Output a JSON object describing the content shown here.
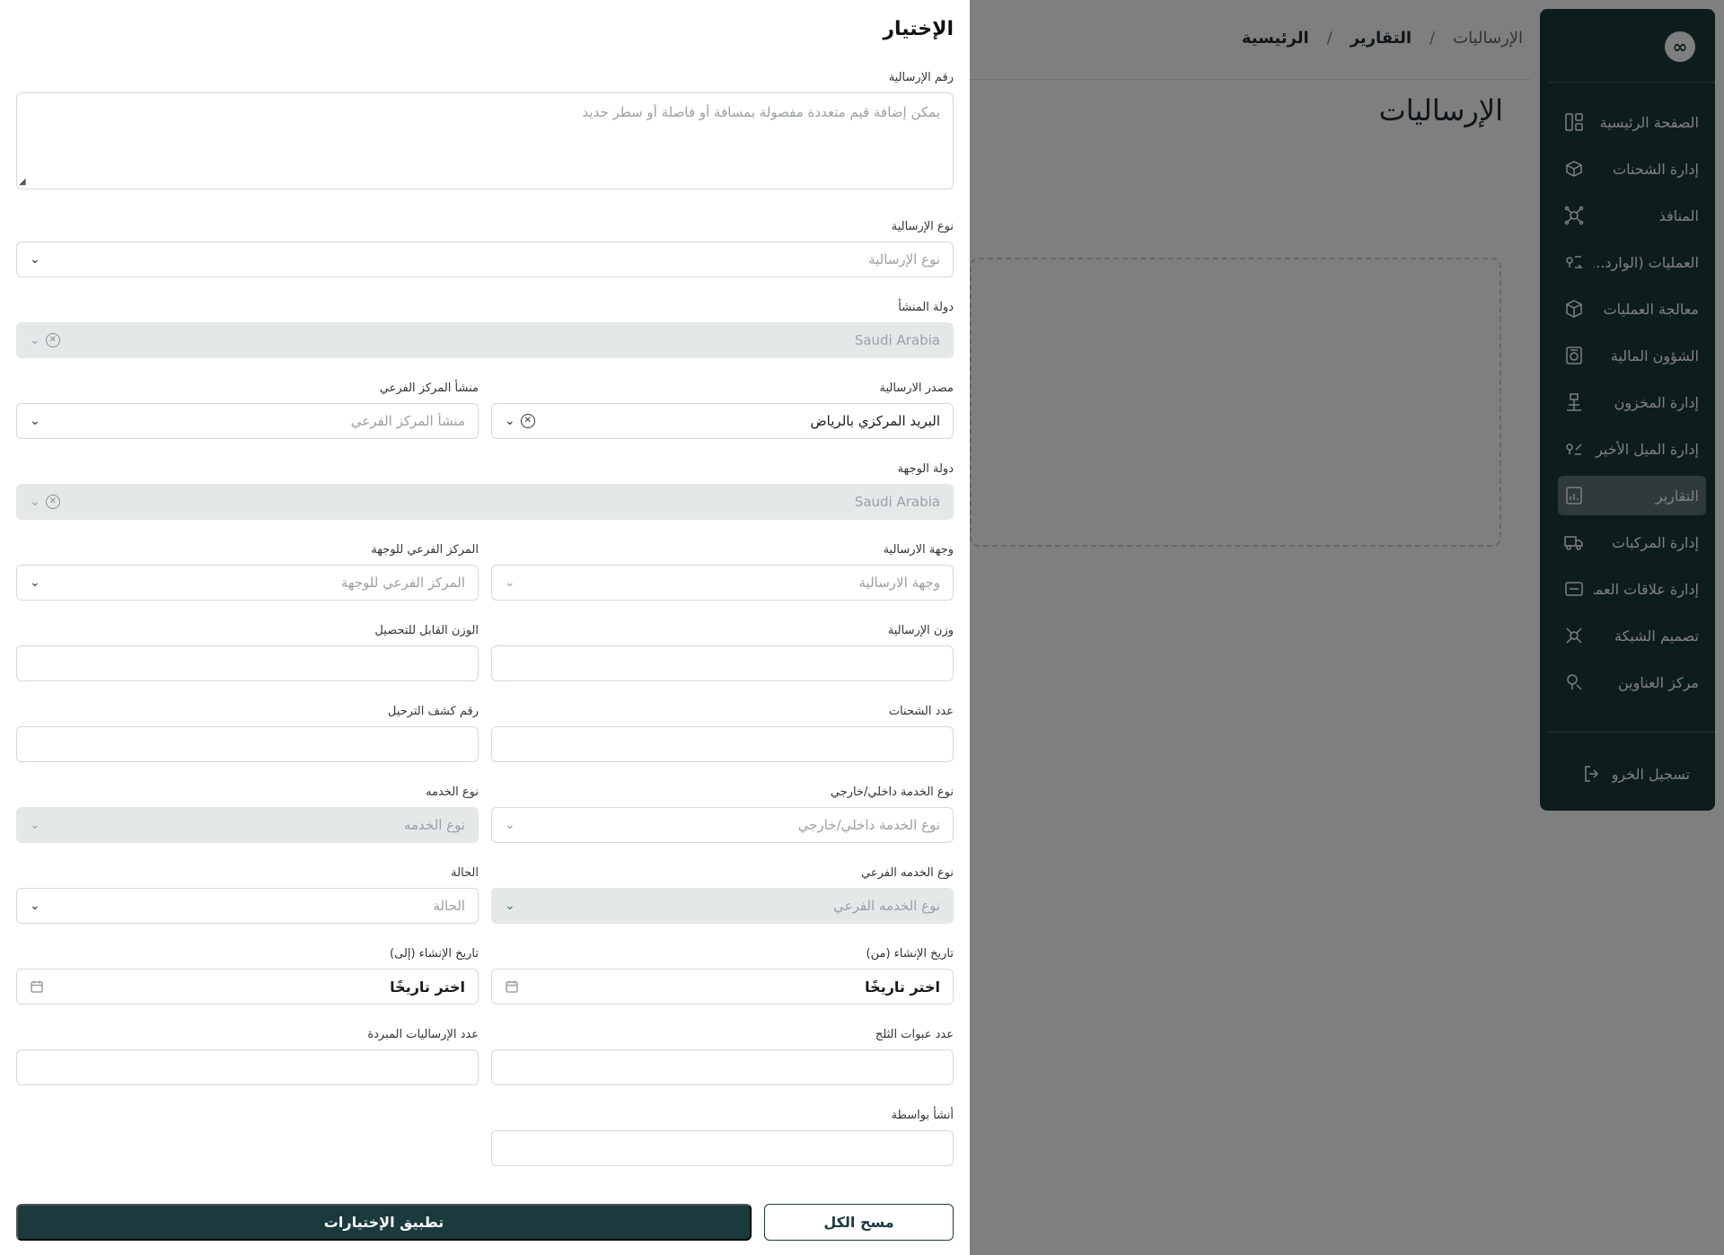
{
  "breadcrumb": {
    "home": "الرئيسية",
    "reports": "التقارير",
    "current": "الإرساليات",
    "sep": "/"
  },
  "page": {
    "title": "الإرساليات"
  },
  "sidebar": {
    "logo": "∞",
    "items": [
      {
        "label": "الصفحة الرئيسية",
        "icon": "dashboard-icon"
      },
      {
        "label": "إدارة الشحنات",
        "icon": "package-icon"
      },
      {
        "label": "المنافذ",
        "icon": "network-icon"
      },
      {
        "label": "العمليات (الوارد...",
        "icon": "location-route-icon"
      },
      {
        "label": "معالجة العمليات",
        "icon": "box-icon"
      },
      {
        "label": "الشؤون المالية",
        "icon": "finance-icon"
      },
      {
        "label": "إدارة المخزون",
        "icon": "inventory-icon"
      },
      {
        "label": "إدارة الميل الأخير",
        "icon": "last-mile-icon"
      },
      {
        "label": "التقارير",
        "icon": "reports-icon",
        "active": true
      },
      {
        "label": "إدارة المركبات",
        "icon": "truck-icon"
      },
      {
        "label": "إدارة علاقات العملاء",
        "icon": "crm-icon"
      },
      {
        "label": "تصميم الشبكة",
        "icon": "network-design-icon"
      },
      {
        "label": "مركز العناوين",
        "icon": "address-icon"
      }
    ],
    "logout": "تسجيل الخروج"
  },
  "drawer": {
    "title": "الإختيار",
    "shipment_number": {
      "label": "رقم الإرسالية",
      "placeholder": "يمكن إضافة قيم متعددة مفصولة بمسافة أو فاصلة أو سطر جديد"
    },
    "shipment_type": {
      "label": "نوع الإرسالية",
      "placeholder": "نوع الإرسالية"
    },
    "origin_country": {
      "label": "دولة المنشأ",
      "value": "Saudi Arabia"
    },
    "shipment_source": {
      "label": "مصدر الارسالية",
      "value": "البريد المركزي بالرياض"
    },
    "branch_origin": {
      "label": "منشأ المركز الفرعي",
      "placeholder": "منشأ المركز الفرعي"
    },
    "destination_country": {
      "label": "دولة الوجهة",
      "value": "Saudi Arabia"
    },
    "shipment_destination": {
      "label": "وجهة الارسالية",
      "placeholder": "وجهة الارسالية"
    },
    "branch_destination": {
      "label": "المركز الفرعي للوجهة",
      "placeholder": "المركز الفرعي للوجهة"
    },
    "shipment_weight": {
      "label": "وزن الإرسالية",
      "value": ""
    },
    "chargeable_weight": {
      "label": "الوزن القابل للتحصيل",
      "value": ""
    },
    "parcels_count": {
      "label": "عدد الشحنات",
      "value": ""
    },
    "manifest_number": {
      "label": "رقم كشف الترحيل",
      "value": ""
    },
    "service_scope": {
      "label": "نوع الخدمة داخلي/خارجي",
      "placeholder": "نوع الخدمة داخلي/خارجي"
    },
    "service_type": {
      "label": "نوع الخدمه",
      "placeholder": "نوع الخدمه"
    },
    "service_subtype": {
      "label": "نوع الخدمه الفرعي",
      "placeholder": "نوع الخدمه الفرعي"
    },
    "status": {
      "label": "الحالة",
      "placeholder": "الحالة"
    },
    "created_from": {
      "label": "تاريخ الإنشاء (من)",
      "value": "اختر تاريخًا"
    },
    "created_to": {
      "label": "تاريخ الإنشاء (إلى)",
      "value": "اختر تاريخًا"
    },
    "ice_packs": {
      "label": "عدد عبوات الثلج",
      "value": ""
    },
    "chilled_shipments": {
      "label": "عدد الإرساليات المبردة",
      "value": ""
    },
    "created_by": {
      "label": "أنشأ بواسطة",
      "value": ""
    },
    "buttons": {
      "clear": "مسح الكل",
      "apply": "تطبيق الإختيارات"
    }
  },
  "colors": {
    "primary": "#1b3a3d",
    "active_item": "#5d7476",
    "overlay": "rgba(0,0,0,0.5)"
  }
}
